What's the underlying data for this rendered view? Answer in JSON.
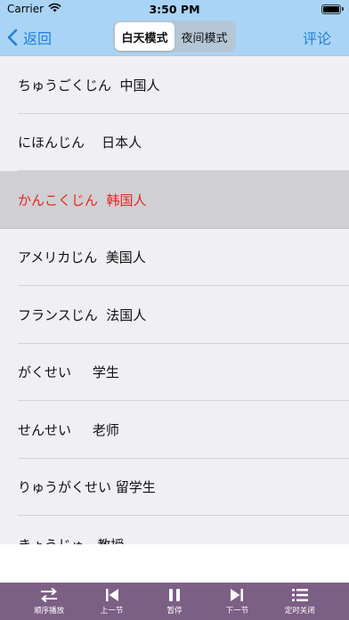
{
  "status_bar": {
    "carrier": "Carrier",
    "time": "3:50 PM"
  },
  "nav": {
    "back_label": "返回",
    "modes": [
      "白天模式",
      "夜间模式"
    ],
    "active_mode": "白天模式",
    "comment_label": "评论",
    "accent_color": "#1d7fe0",
    "bar_color": "#a9d4f6"
  },
  "list": {
    "items": [
      "ちゅうごくじん  中国人",
      "にほんじん    日本人",
      "かんこくじん  韩国人",
      "アメリカじん  美国人",
      "フランスじん  法国人",
      "がくせい     学生",
      "せんせい     老师",
      "りゅうがくせい 留学生",
      "きょうじゅ   教授"
    ],
    "selected_index": 2,
    "selected_color": "#e8231b"
  },
  "toolbar": {
    "color": "#7c5f84",
    "buttons": [
      {
        "icon": "shuffle-icon",
        "label": "顺序播放"
      },
      {
        "icon": "previous-icon",
        "label": "上一节"
      },
      {
        "icon": "pause-icon",
        "label": "暂停"
      },
      {
        "icon": "next-icon",
        "label": "下一节"
      },
      {
        "icon": "list-icon",
        "label": "定时关闭"
      }
    ]
  }
}
